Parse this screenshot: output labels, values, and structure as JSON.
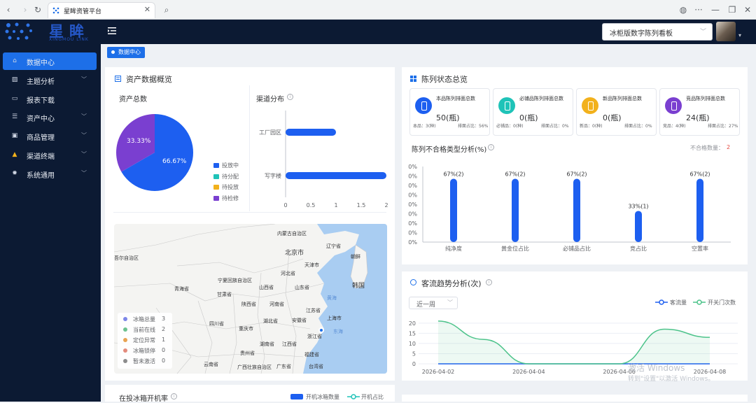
{
  "browser": {
    "tab_title": "星眸资管平台",
    "back": "‹",
    "forward": "›",
    "reload": "↻",
    "close": "✕",
    "search": "⌕",
    "globe": "◍",
    "more": "···",
    "minimize": "—",
    "restore": "❐",
    "close_window": "✕"
  },
  "header": {
    "logo": "星眸",
    "logo_sub": "XINGMOU LINK",
    "board_select": "冰柜版数字陈列看板"
  },
  "sidebar": {
    "items": [
      {
        "label": "数据中心",
        "active": true,
        "chevron": false
      },
      {
        "label": "主题分析",
        "active": false,
        "chevron": true
      },
      {
        "label": "报表下载",
        "active": false,
        "chevron": false
      },
      {
        "label": "资产中心",
        "active": false,
        "chevron": true
      },
      {
        "label": "商品管理",
        "active": false,
        "chevron": true
      },
      {
        "label": "渠道终端",
        "active": false,
        "chevron": true
      },
      {
        "label": "系统通用",
        "active": false,
        "chevron": true
      }
    ]
  },
  "breadcrumb": "数据中心",
  "asset_overview": {
    "title": "资产数据概览",
    "total_title": "资产总数",
    "channel_title": "渠道分布",
    "pie_legend": [
      "投放中",
      "待分配",
      "待投放",
      "待检修"
    ],
    "pie_labels": [
      "66.67%",
      "33.33%"
    ],
    "channel_categories": [
      "工厂园区",
      "写字楼"
    ],
    "channel_ticks": [
      "0",
      "0.5",
      "1",
      "1.5",
      "2"
    ]
  },
  "map": {
    "legend": [
      {
        "name": "冰箱总量",
        "count": "3",
        "color": "#7d86e8"
      },
      {
        "name": "当前在线",
        "count": "2",
        "color": "#6cc28f"
      },
      {
        "name": "定位异常",
        "count": "1",
        "color": "#e8a352"
      },
      {
        "name": "冰箱锁停",
        "count": "0",
        "color": "#e38b7c"
      },
      {
        "name": "暂未激活",
        "count": "0",
        "color": "#8c8c8c"
      }
    ],
    "labels": [
      "内蒙古自治区",
      "北京市",
      "辽宁省",
      "朝鲜",
      "天津市",
      "河北省",
      "宁夏回族自治区",
      "山西省",
      "山东省",
      "青海省",
      "甘肃省",
      "陕西省",
      "河南省",
      "韩国",
      "江苏省",
      "四川省",
      "湖北省",
      "安徽省",
      "上海市",
      "重庆市",
      "浙江省",
      "湖南省",
      "江西省",
      "贵州省",
      "福建省",
      "云南省",
      "广西壮族自治区",
      "广东省",
      "台湾省",
      "黄海",
      "东海",
      "吾尔自治区"
    ]
  },
  "fridge_on_rate": {
    "title": "在投冰箱开机率",
    "legend": [
      "开机冰箱数量",
      "开机占比"
    ]
  },
  "display_status": {
    "title": "陈列状态总览",
    "cards": [
      {
        "title": "本品陈列排面总数",
        "value": "50(瓶)",
        "foot1": "本品：3(种)",
        "foot2": "排面占比：56%",
        "color": "#1d5ff0"
      },
      {
        "title": "必铺品陈列排面总数",
        "value": "0(瓶)",
        "foot1": "必铺品：0(种)",
        "foot2": "排面占比：0%",
        "color": "#1fc3b8"
      },
      {
        "title": "新品陈列排面总数",
        "value": "0(瓶)",
        "foot1": "新品：0(种)",
        "foot2": "排面占比：0%",
        "color": "#f2b11c"
      },
      {
        "title": "竞品陈列排面总数",
        "value": "24(瓶)",
        "foot1": "竞品：4(种)",
        "foot2": "排面占比：27%",
        "color": "#7a3fd0"
      }
    ],
    "unqualified_title": "陈列不合格类型分析(%)",
    "unqualified_count_label": "不合格数量：",
    "unqualified_count": "2"
  },
  "traffic": {
    "title": "客流趋势分析(次)",
    "period": "近一周",
    "legend": [
      "客流量",
      "开关门次数"
    ]
  },
  "watermark": {
    "line1": "激活 Windows",
    "line2": "转到\"设置\"以激活 Windows。"
  },
  "chart_data": [
    {
      "type": "pie",
      "title": "资产总数",
      "categories": [
        "投放中",
        "待分配",
        "待投放",
        "待检修"
      ],
      "values": [
        66.67,
        0,
        0,
        33.33
      ],
      "colors": [
        "#1d5ff0",
        "#1fc3b8",
        "#f2b11c",
        "#7a3fd0"
      ]
    },
    {
      "type": "bar",
      "title": "渠道分布",
      "orientation": "horizontal",
      "categories": [
        "工厂园区",
        "写字楼"
      ],
      "values": [
        1,
        2
      ],
      "xlim": [
        0,
        2
      ],
      "xticks": [
        "0",
        "0.5",
        "1",
        "1.5",
        "2"
      ],
      "color": "#1d5ff0"
    },
    {
      "type": "bar",
      "title": "陈列不合格类型分析(%)",
      "categories": [
        "纯净度",
        "黄金位占比",
        "必铺品占比",
        "竞占比",
        "空置率"
      ],
      "values": [
        67,
        67,
        67,
        33,
        67
      ],
      "data_labels": [
        "67%(2)",
        "67%(2)",
        "67%(2)",
        "33%(1)",
        "67%(2)"
      ],
      "yticks": [
        "0%",
        "0%",
        "0%",
        "0%",
        "0%",
        "0%",
        "0%",
        "0%",
        "0%"
      ],
      "ylim": [
        0,
        80
      ],
      "color": "#1d5ff0"
    },
    {
      "type": "line",
      "title": "客流趋势分析(次)",
      "x": [
        "2026-04-02",
        "2026-04-03",
        "2026-04-04",
        "2026-04-05",
        "2026-04-06",
        "2026-04-07",
        "2026-04-08"
      ],
      "xticks": [
        "2026-04-02",
        "2026-04-04",
        "2026-04-06",
        "2026-04-08"
      ],
      "yticks": [
        "0",
        "5",
        "10",
        "15",
        "20"
      ],
      "ylim": [
        0,
        22
      ],
      "series": [
        {
          "name": "客流量",
          "values": [
            0,
            0,
            0,
            0,
            0,
            0,
            0
          ],
          "color": "#1d5ff0"
        },
        {
          "name": "开关门次数",
          "values": [
            21,
            12,
            0,
            0,
            0,
            17,
            13
          ],
          "color": "#4cc38a"
        }
      ]
    }
  ]
}
